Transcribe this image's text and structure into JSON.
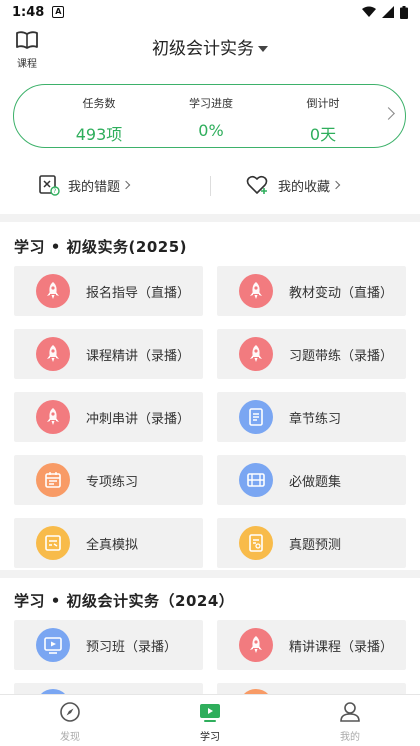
{
  "status": {
    "time": "1:48",
    "notif": "A"
  },
  "header": {
    "course_label": "课程",
    "title": "初级会计实务"
  },
  "stats": [
    {
      "key": "任务数",
      "value": "493项"
    },
    {
      "key": "学习进度",
      "value": "0%"
    },
    {
      "key": "倒计时",
      "value": "0天"
    }
  ],
  "quick": {
    "wrong": "我的错题",
    "fav": "我的收藏"
  },
  "section1": {
    "title": "学习 • 初级实务(2025)",
    "items": [
      {
        "label": "报名指导（直播）",
        "icon": "rocket-icon"
      },
      {
        "label": "教材变动（直播）",
        "icon": "rocket-icon"
      },
      {
        "label": "课程精讲（录播）",
        "icon": "rocket-icon"
      },
      {
        "label": "习题带练（录播）",
        "icon": "rocket-icon"
      },
      {
        "label": "冲刺串讲（录播）",
        "icon": "rocket-icon"
      },
      {
        "label": "章节练习",
        "icon": "document-icon"
      },
      {
        "label": "专项练习",
        "icon": "calendar-icon"
      },
      {
        "label": "必做题集",
        "icon": "film-icon"
      },
      {
        "label": "全真模拟",
        "icon": "exam-icon"
      },
      {
        "label": "真题预测",
        "icon": "prediction-icon"
      }
    ]
  },
  "section2": {
    "title": "学习 • 初级会计实务（2024）",
    "items": [
      {
        "label": "预习班（录播）",
        "icon": "video-icon"
      },
      {
        "label": "精讲课程（录播）",
        "icon": "rocket-icon"
      }
    ]
  },
  "nav": {
    "discover": "发现",
    "study": "学习",
    "mine": "我的"
  },
  "colors": {
    "accent": "#2fae5c",
    "red": "#f27b7f",
    "blue": "#7aa6f2",
    "orange": "#f89b66",
    "yellow": "#f8bb4a"
  }
}
